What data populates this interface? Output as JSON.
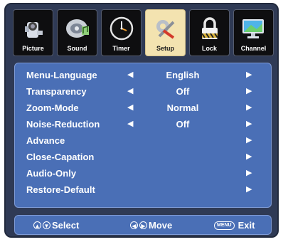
{
  "tabs": [
    {
      "label": "Picture",
      "icon": "camera-icon",
      "active": false
    },
    {
      "label": "Sound",
      "icon": "speaker-icon",
      "active": false
    },
    {
      "label": "Timer",
      "icon": "clock-icon",
      "active": false
    },
    {
      "label": "Setup",
      "icon": "tools-icon",
      "active": true
    },
    {
      "label": "Lock",
      "icon": "padlock-icon",
      "active": false
    },
    {
      "label": "Channel",
      "icon": "monitor-icon",
      "active": false
    }
  ],
  "menu": {
    "items": [
      {
        "label": "Menu-Language",
        "value": "English"
      },
      {
        "label": "Transparency",
        "value": "Off"
      },
      {
        "label": "Zoom-Mode",
        "value": "Normal"
      },
      {
        "label": "Noise-Reduction",
        "value": "Off"
      },
      {
        "label": "Advance",
        "value": ""
      },
      {
        "label": "Close-Capation",
        "value": ""
      },
      {
        "label": "Audio-Only",
        "value": ""
      },
      {
        "label": "Restore-Default",
        "value": ""
      }
    ],
    "left_arrow": "◀",
    "right_arrow": "▶"
  },
  "footer": {
    "select": "Select",
    "move": "Move",
    "menu_key": "MENU",
    "exit": "Exit"
  },
  "colors": {
    "frame": "#2f3a55",
    "panel": "#4a6fb6",
    "active_tab": "#f3e3b0"
  }
}
